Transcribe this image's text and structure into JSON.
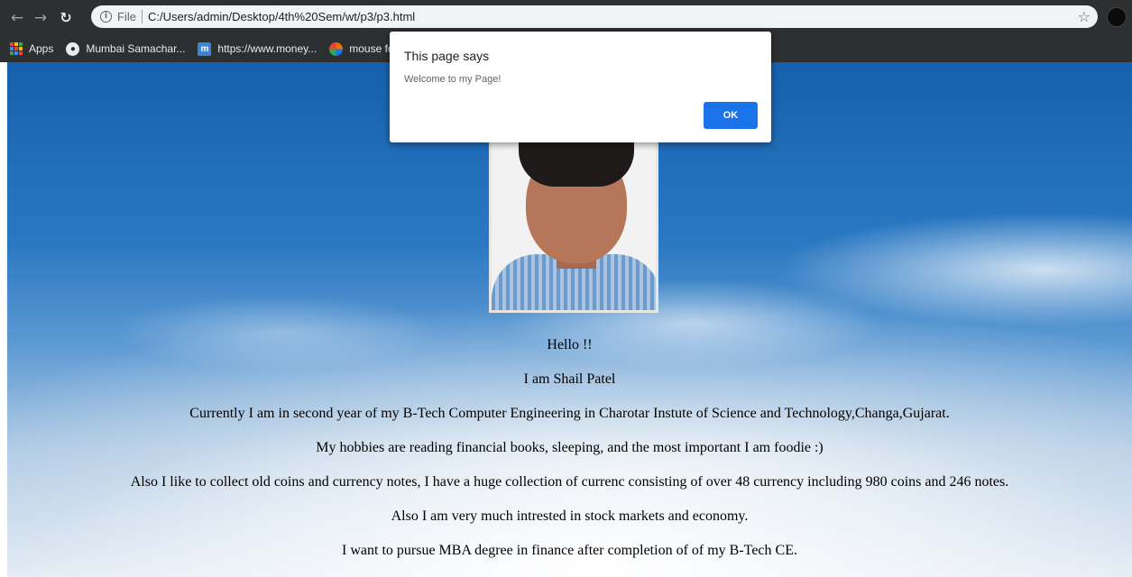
{
  "browser": {
    "address_scheme": "File",
    "address_url": "C:/Users/admin/Desktop/4th%20Sem/wt/p3/p3.html"
  },
  "bookmarks": [
    {
      "label": "Apps",
      "icon": "apps-grid-icon"
    },
    {
      "label": "Mumbai Samachar...",
      "icon": "globe-icon"
    },
    {
      "label": "https://www.money...",
      "icon": "moneycontrol-icon"
    },
    {
      "label": "mouse fo",
      "icon": "colorful-circle-icon"
    }
  ],
  "dialog": {
    "title": "This page says",
    "message": "Welcome to my Page!",
    "ok_label": "OK"
  },
  "page": {
    "lines": [
      "Hello !!",
      "I am Shail Patel",
      "Currently I am in second year of my B-Tech Computer Engineering in Charotar Instute of Science and Technology,Changa,Gujarat.",
      "My hobbies are reading financial books, sleeping, and the most important I am foodie :)",
      "Also I like to collect old coins and currency notes, I have a huge collection of currenc consisting of over 48 currency including 980 coins and 246 notes.",
      "Also I am very much intrested in stock markets and economy.",
      "I want to pursue MBA degree in finance after completion of of my B-Tech CE."
    ]
  },
  "colors": {
    "toolbar_bg": "#2e2f31",
    "ok_button": "#1a73e8"
  }
}
